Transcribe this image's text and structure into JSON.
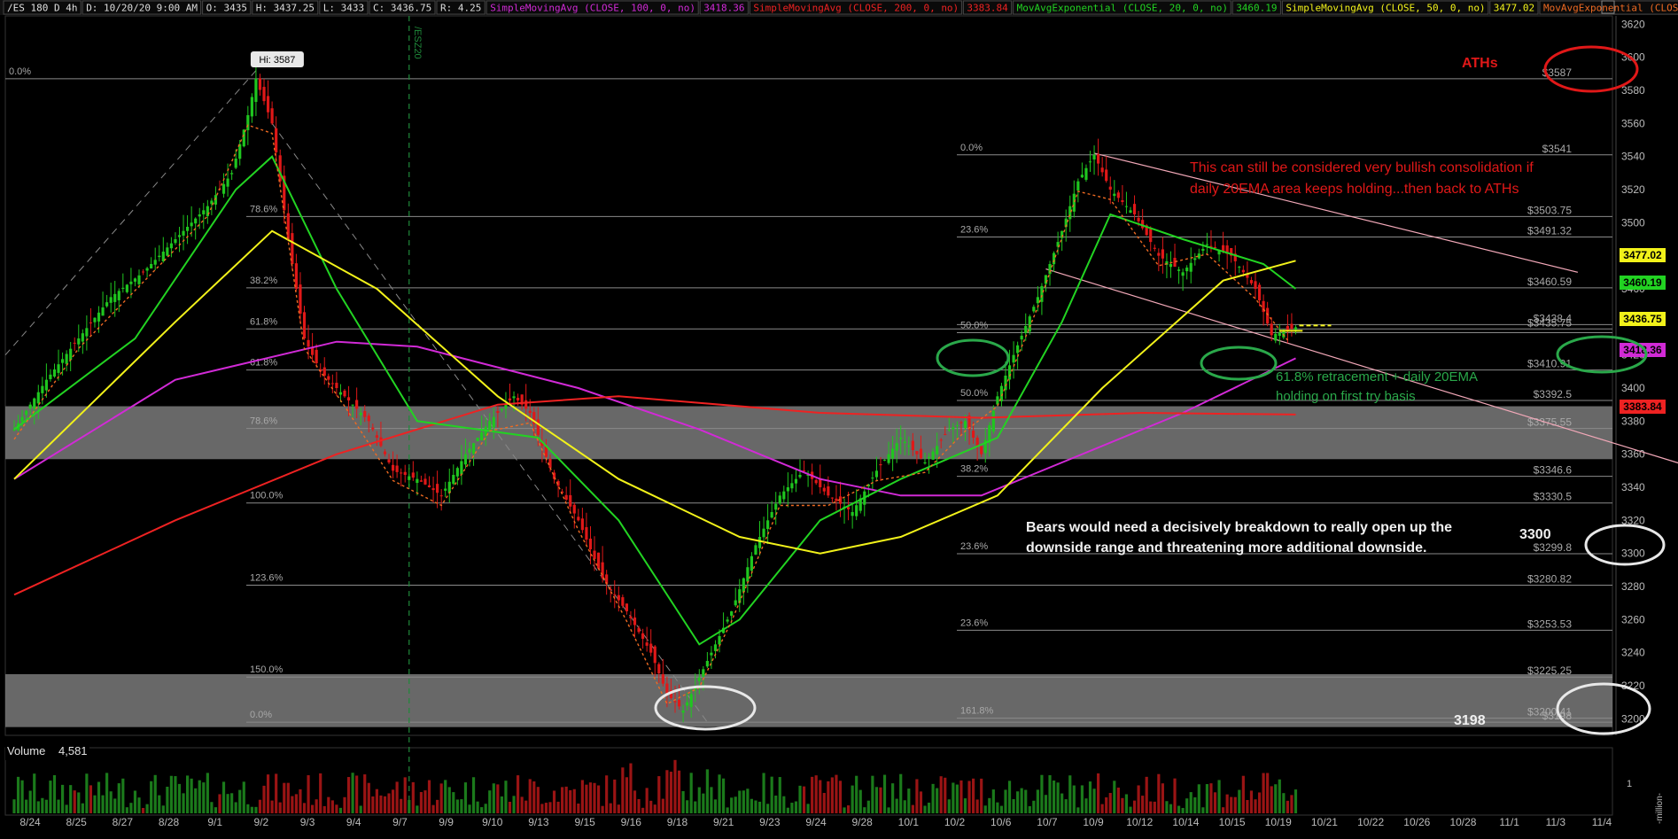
{
  "header": {
    "symbol": "/ES 180 D 4h",
    "ohlc": [
      {
        "text": "D: 10/20/20 9:00 AM",
        "color": "#dddddd"
      },
      {
        "text": "O: 3435",
        "color": "#dddddd"
      },
      {
        "text": "H: 3437.25",
        "color": "#dddddd"
      },
      {
        "text": "L: 3433",
        "color": "#dddddd"
      },
      {
        "text": "C: 3436.75",
        "color": "#dddddd"
      },
      {
        "text": "R: 4.25",
        "color": "#dddddd"
      }
    ],
    "studies": [
      {
        "name": "SimpleMovingAvg (CLOSE, 100, 0, no)",
        "value": "3418.36",
        "color": "#d12ad6"
      },
      {
        "name": "SimpleMovingAvg (CLOSE, 200, 0, no)",
        "value": "3383.84",
        "color": "#ee2222"
      },
      {
        "name": "MovAvgExponential (CLOSE, 20, 0, no)",
        "value": "3460.19",
        "color": "#22d322"
      },
      {
        "name": "SimpleMovingAvg (CLOSE, 50, 0, no)",
        "value": "3477.02",
        "color": "#f2f21a"
      },
      {
        "name": "MovAvgExponential (CLOSE...",
        "value": "",
        "color": "#ee6a22"
      }
    ]
  },
  "chart_data": {
    "type": "candlestick",
    "symbol": "/ES",
    "timeframe": "4h",
    "ylim": [
      3190,
      3625
    ],
    "price_axis_ticks": [
      3200,
      3220,
      3240,
      3260,
      3280,
      3300,
      3320,
      3340,
      3360,
      3380,
      3400,
      3420,
      3440,
      3460,
      3480,
      3500,
      3520,
      3540,
      3560,
      3580,
      3600,
      3620
    ],
    "date_ticks": [
      "8/24",
      "8/25",
      "8/27",
      "8/28",
      "9/1",
      "9/2",
      "9/3",
      "9/4",
      "9/7",
      "9/9",
      "9/10",
      "9/13",
      "9/15",
      "9/16",
      "9/18",
      "9/21",
      "9/23",
      "9/24",
      "9/28",
      "10/1",
      "10/2",
      "10/6",
      "10/7",
      "10/9",
      "10/12",
      "10/14",
      "10/15",
      "10/19",
      "10/21",
      "10/22",
      "10/26",
      "10/28",
      "11/1",
      "11/3",
      "11/4"
    ],
    "price_path": [
      [
        0,
        3375
      ],
      [
        8,
        3405
      ],
      [
        16,
        3430
      ],
      [
        24,
        3455
      ],
      [
        32,
        3470
      ],
      [
        40,
        3490
      ],
      [
        48,
        3510
      ],
      [
        54,
        3530
      ],
      [
        58,
        3565
      ],
      [
        60,
        3587
      ],
      [
        64,
        3560
      ],
      [
        68,
        3490
      ],
      [
        72,
        3430
      ],
      [
        76,
        3410
      ],
      [
        82,
        3395
      ],
      [
        88,
        3380
      ],
      [
        94,
        3350
      ],
      [
        100,
        3345
      ],
      [
        106,
        3335
      ],
      [
        112,
        3360
      ],
      [
        118,
        3380
      ],
      [
        124,
        3395
      ],
      [
        128,
        3385
      ],
      [
        134,
        3345
      ],
      [
        140,
        3320
      ],
      [
        146,
        3285
      ],
      [
        152,
        3265
      ],
      [
        158,
        3240
      ],
      [
        162,
        3215
      ],
      [
        166,
        3205
      ],
      [
        170,
        3225
      ],
      [
        174,
        3245
      ],
      [
        178,
        3265
      ],
      [
        184,
        3305
      ],
      [
        190,
        3335
      ],
      [
        196,
        3350
      ],
      [
        202,
        3335
      ],
      [
        208,
        3325
      ],
      [
        214,
        3350
      ],
      [
        220,
        3370
      ],
      [
        226,
        3355
      ],
      [
        232,
        3375
      ],
      [
        236,
        3380
      ],
      [
        240,
        3360
      ],
      [
        244,
        3395
      ],
      [
        248,
        3420
      ],
      [
        254,
        3455
      ],
      [
        260,
        3495
      ],
      [
        264,
        3525
      ],
      [
        268,
        3541
      ],
      [
        272,
        3520
      ],
      [
        278,
        3505
      ],
      [
        284,
        3480
      ],
      [
        290,
        3470
      ],
      [
        296,
        3487
      ],
      [
        302,
        3480
      ],
      [
        308,
        3460
      ],
      [
        312,
        3432
      ],
      [
        316,
        3435
      ],
      [
        318,
        3436.75
      ]
    ],
    "volume_label": "Volume",
    "volume_value": "4,581",
    "volume_axis": [
      "1",
      "-million-"
    ],
    "moving_averages": [
      {
        "name": "SMA 100",
        "value": 3418.36,
        "color": "#d12ad6",
        "path": [
          [
            0,
            3345
          ],
          [
            40,
            3405
          ],
          [
            80,
            3428
          ],
          [
            100,
            3425
          ],
          [
            140,
            3400
          ],
          [
            170,
            3375
          ],
          [
            200,
            3345
          ],
          [
            220,
            3335
          ],
          [
            240,
            3335
          ],
          [
            260,
            3355
          ],
          [
            290,
            3385
          ],
          [
            318,
            3418
          ]
        ]
      },
      {
        "name": "SMA 200",
        "value": 3383.84,
        "color": "#ee2222",
        "path": [
          [
            0,
            3275
          ],
          [
            40,
            3320
          ],
          [
            80,
            3360
          ],
          [
            120,
            3390
          ],
          [
            150,
            3395
          ],
          [
            200,
            3385
          ],
          [
            240,
            3382
          ],
          [
            280,
            3385
          ],
          [
            318,
            3384
          ]
        ]
      },
      {
        "name": "EMA 20",
        "value": 3460.19,
        "color": "#22d322",
        "path": [
          [
            0,
            3375
          ],
          [
            30,
            3430
          ],
          [
            55,
            3520
          ],
          [
            64,
            3540
          ],
          [
            80,
            3460
          ],
          [
            100,
            3380
          ],
          [
            130,
            3370
          ],
          [
            150,
            3320
          ],
          [
            170,
            3245
          ],
          [
            180,
            3260
          ],
          [
            200,
            3320
          ],
          [
            220,
            3345
          ],
          [
            244,
            3370
          ],
          [
            260,
            3440
          ],
          [
            272,
            3505
          ],
          [
            290,
            3490
          ],
          [
            310,
            3475
          ],
          [
            318,
            3460
          ]
        ]
      },
      {
        "name": "SMA 50",
        "value": 3477.02,
        "color": "#f2f21a",
        "path": [
          [
            0,
            3345
          ],
          [
            40,
            3440
          ],
          [
            64,
            3495
          ],
          [
            90,
            3460
          ],
          [
            120,
            3395
          ],
          [
            150,
            3345
          ],
          [
            180,
            3310
          ],
          [
            200,
            3300
          ],
          [
            220,
            3310
          ],
          [
            244,
            3335
          ],
          [
            270,
            3400
          ],
          [
            300,
            3465
          ],
          [
            318,
            3477
          ]
        ]
      }
    ],
    "horizontal_levels": [
      {
        "price": 3587,
        "label": "$3587",
        "left_label": "0.0%"
      },
      {
        "price": 3541,
        "label": "$3541",
        "left_label": "0.0%"
      },
      {
        "price": 3503.75,
        "label": "$3503.75",
        "left_label": "78.6%"
      },
      {
        "price": 3491.32,
        "label": "$3491.32",
        "left_label": "23.6%"
      },
      {
        "price": 3460.59,
        "label": "$3460.59",
        "left_label": "38.2%"
      },
      {
        "price": 3438.4,
        "label": "$3438.4",
        "left_label": ""
      },
      {
        "price": 3435.75,
        "label": "$3435.75",
        "left_label": "61.8%"
      },
      {
        "price": 3433.5,
        "label": "",
        "left_label": "50.0%"
      },
      {
        "price": 3410.91,
        "label": "$3410.91",
        "left_label": "61.8%"
      },
      {
        "price": 3392.5,
        "label": "$3392.5",
        "left_label": "50.0%"
      },
      {
        "price": 3375.55,
        "label": "$3375.55",
        "left_label": "78.6%"
      },
      {
        "price": 3346.6,
        "label": "$3346.6",
        "left_label": "38.2%"
      },
      {
        "price": 3330.5,
        "label": "$3330.5",
        "left_label": "100.0%"
      },
      {
        "price": 3299.8,
        "label": "$3299.8",
        "left_label": "23.6%"
      },
      {
        "price": 3280.82,
        "label": "$3280.82",
        "left_label": "123.6%"
      },
      {
        "price": 3253.53,
        "label": "$3253.53",
        "left_label": "23.6%"
      },
      {
        "price": 3225.25,
        "label": "$3225.25",
        "left_label": "150.0%"
      },
      {
        "price": 3200.41,
        "label": "$3200.41",
        "left_label": "161.8%"
      },
      {
        "price": 3198,
        "label": "$3198",
        "left_label": "0.0%"
      }
    ],
    "zones": [
      {
        "from": 3357,
        "to": 3389
      },
      {
        "from": 3195,
        "to": 3227
      }
    ],
    "right_badges": [
      {
        "value": "3477.02",
        "color": "#f2f21a"
      },
      {
        "value": "3460.19",
        "color": "#22d322"
      },
      {
        "value": "3436.75",
        "color": "#f2f21a"
      },
      {
        "value": "3418.36",
        "color": "#d12ad6"
      },
      {
        "value": "3383.84",
        "color": "#ee2222"
      }
    ],
    "annotations": {
      "hi_label": "Hi: 3587",
      "vertical_line_label": "/ESZ20",
      "aths": "ATHs",
      "bullish_note": [
        "This can still be considered very bullish consolidation if",
        "daily 20EMA area keeps holding...then back to ATHs"
      ],
      "green_note": [
        "61.8% retracement + daily 20EMA",
        "holding on first try basis"
      ],
      "bears_note": [
        "Bears would need a decisively breakdown to really open up the",
        "downside range and threatening more additional downside."
      ],
      "label_3300": "3300",
      "label_3198": "3198"
    }
  }
}
